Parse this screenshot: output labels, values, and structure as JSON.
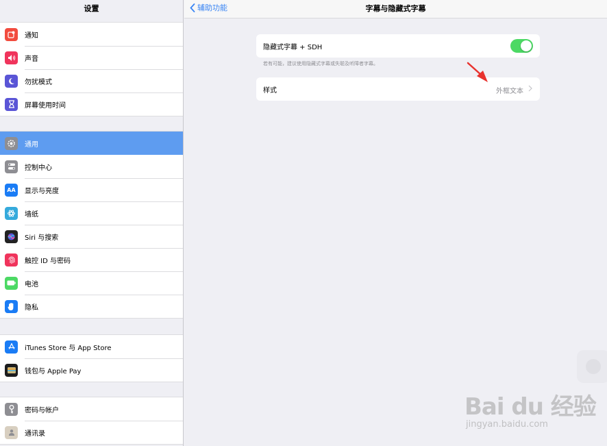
{
  "sidebar": {
    "title": "设置",
    "groups": [
      {
        "items": [
          {
            "label": "通知",
            "icon": "notifications-icon",
            "color": "#f24b3e"
          },
          {
            "label": "声音",
            "icon": "sounds-icon",
            "color": "#f0345c"
          },
          {
            "label": "勿扰模式",
            "icon": "moon-icon",
            "color": "#5a55d6"
          },
          {
            "label": "屏幕使用时间",
            "icon": "hourglass-icon",
            "color": "#5a55d6"
          }
        ]
      },
      {
        "items": [
          {
            "label": "通用",
            "icon": "gear-icon",
            "color": "#8e8e93",
            "selected": true
          },
          {
            "label": "控制中心",
            "icon": "toggles-icon",
            "color": "#8e8e93"
          },
          {
            "label": "显示与亮度",
            "icon": "text-size-icon",
            "color": "#1a7cf5"
          },
          {
            "label": "墙纸",
            "icon": "flower-icon",
            "color": "#35aadc"
          },
          {
            "label": "Siri 与搜索",
            "icon": "siri-icon",
            "color": "#222"
          },
          {
            "label": "触控 ID 与密码",
            "icon": "fingerprint-icon",
            "color": "#f0345c"
          },
          {
            "label": "电池",
            "icon": "battery-icon",
            "color": "#4cd964"
          },
          {
            "label": "隐私",
            "icon": "hand-icon",
            "color": "#1a7cf5"
          }
        ]
      },
      {
        "items": [
          {
            "label": "iTunes Store 与 App Store",
            "icon": "app-store-icon",
            "color": "#1a7cf5"
          },
          {
            "label": "钱包与 Apple Pay",
            "icon": "wallet-icon",
            "color": "#1c1c1e"
          }
        ]
      },
      {
        "items": [
          {
            "label": "密码与帐户",
            "icon": "key-icon",
            "color": "#8e8e93"
          },
          {
            "label": "通讯录",
            "icon": "contacts-icon",
            "color": "#d8cfc0"
          }
        ]
      }
    ]
  },
  "nav": {
    "back_label": "辅助功能",
    "title": "字幕与隐藏式字幕"
  },
  "settings": {
    "cc_sdh_label": "隐藏式字幕 + SDH",
    "cc_sdh_on": true,
    "footnote": "若有可能，建议使用隐藏式字幕或失聪及听障者字幕。",
    "style_label": "样式",
    "style_value": "外框文本"
  },
  "watermark": {
    "line1": "Bai du 经验",
    "line2": "jingyan.baidu.com"
  },
  "colors": {
    "accent": "#3a85f4",
    "selected_row": "#5e9cf0",
    "toggle_on": "#4cd964",
    "annotation_arrow": "#e8322e"
  }
}
